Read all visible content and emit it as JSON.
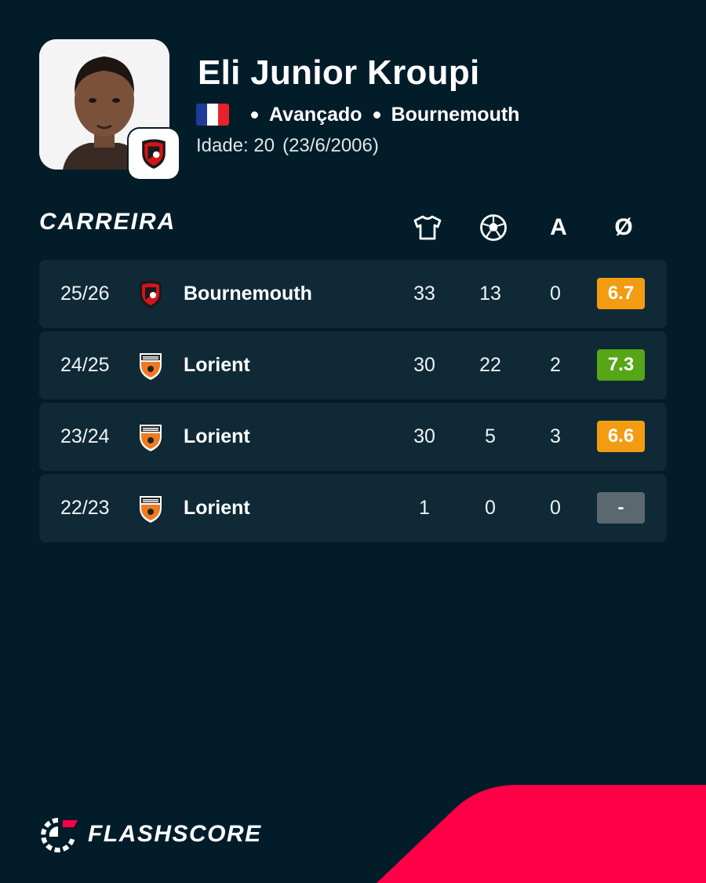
{
  "player": {
    "name": "Eli Junior Kroupi",
    "position": "Avançado",
    "club": "Bournemouth",
    "age_label": "Idade: 20",
    "birth_date": "(23/6/2006)",
    "flag_icon": "france-flag-icon"
  },
  "career": {
    "title": "CARREIRA",
    "columns": {
      "appearances_icon": "shirt-icon",
      "goals_icon": "football-icon",
      "assists_label": "A",
      "rating_label": "Ø"
    },
    "rows": [
      {
        "season": "25/26",
        "team": "Bournemouth",
        "logo": "bournemouth-logo-icon",
        "apps": "33",
        "goals": "13",
        "assists": "0",
        "rating": "6.7",
        "rating_color": "#f39c12"
      },
      {
        "season": "24/25",
        "team": "Lorient",
        "logo": "lorient-logo-icon",
        "apps": "30",
        "goals": "22",
        "assists": "2",
        "rating": "7.3",
        "rating_color": "#56a616"
      },
      {
        "season": "23/24",
        "team": "Lorient",
        "logo": "lorient-logo-icon",
        "apps": "30",
        "goals": "5",
        "assists": "3",
        "rating": "6.6",
        "rating_color": "#f39c12"
      },
      {
        "season": "22/23",
        "team": "Lorient",
        "logo": "lorient-logo-icon",
        "apps": "1",
        "goals": "0",
        "assists": "0",
        "rating": "-",
        "rating_color": "#5b6870"
      }
    ]
  },
  "brand": {
    "name": "FLASHSCORE",
    "accent_color": "#ff0046",
    "background_color": "#021d29"
  }
}
